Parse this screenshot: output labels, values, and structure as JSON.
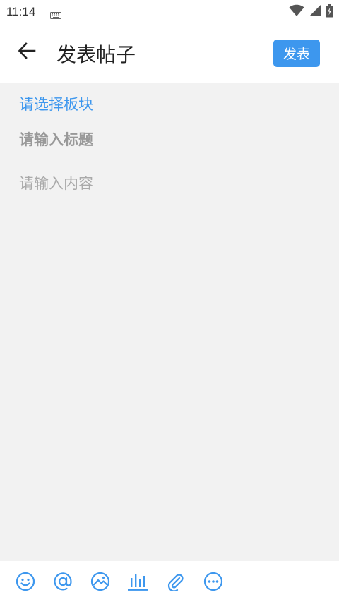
{
  "status_bar": {
    "time": "11:14",
    "icons": [
      "keyboard-icon",
      "wifi-icon",
      "cellular-signal-icon",
      "battery-icon"
    ]
  },
  "toolbar": {
    "back_icon": "arrow-left-icon",
    "title": "发表帖子",
    "publish_label": "发表"
  },
  "editor": {
    "board_select_label": "请选择板块",
    "title_placeholder": "请输入标题",
    "content_placeholder": "请输入内容"
  },
  "bottom_toolbar": {
    "icons": [
      "emoji-icon",
      "mention-icon",
      "image-icon",
      "poll-icon",
      "attachment-icon",
      "more-icon"
    ]
  },
  "colors": {
    "accent": "#3d97ee",
    "content_background": "#f2f2f2",
    "placeholder": "#999999"
  }
}
